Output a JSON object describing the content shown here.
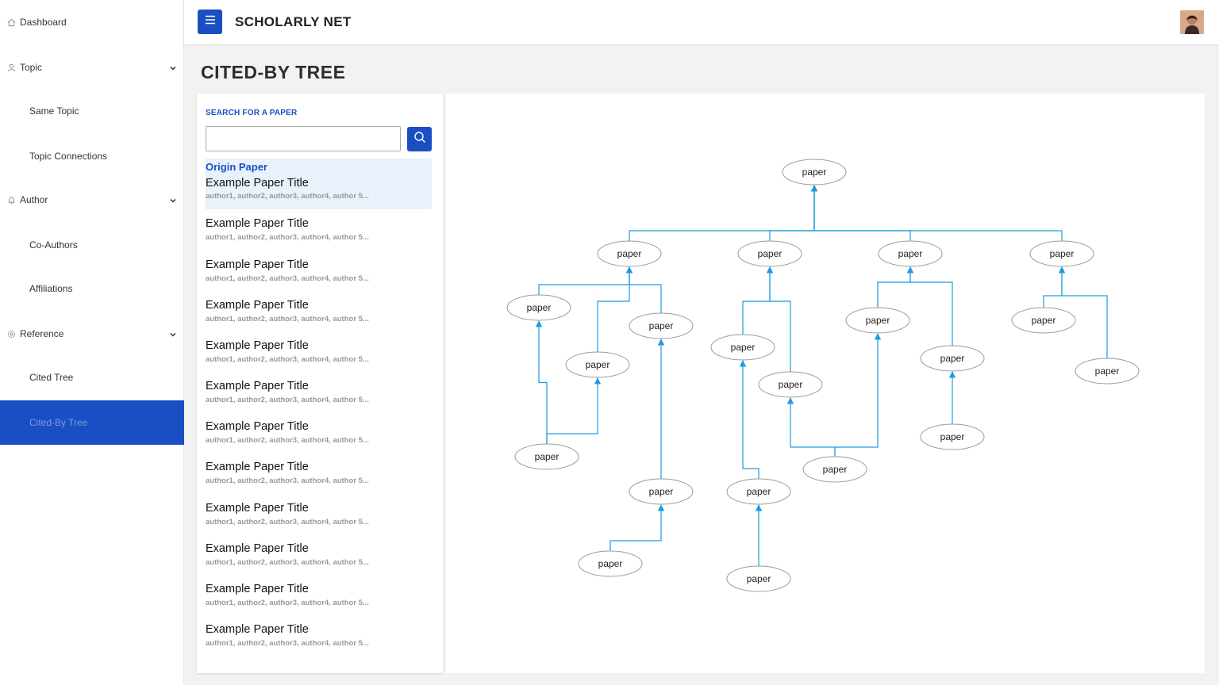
{
  "sidebar": {
    "items": [
      {
        "label": "Dashboard",
        "icon": "home-icon"
      },
      {
        "label": "Topic",
        "icon": "person-icon"
      },
      {
        "label": "Same Topic"
      },
      {
        "label": "Topic Connections"
      },
      {
        "label": "Author",
        "icon": "bell-icon"
      },
      {
        "label": "Co-Authors"
      },
      {
        "label": "Affiliations"
      },
      {
        "label": "Reference",
        "icon": "gear-icon"
      },
      {
        "label": "Cited Tree"
      },
      {
        "label": "Cited-By Tree",
        "active": true
      }
    ]
  },
  "header": {
    "brand": "SCHOLARLY NET",
    "menu_icon": "hamburger-icon",
    "avatar": "user-avatar"
  },
  "page": {
    "title": "CITED-BY TREE"
  },
  "search": {
    "label": "SEARCH FOR A PAPER",
    "value": "",
    "placeholder": "",
    "button_icon": "search-icon"
  },
  "origin": {
    "label": "Origin Paper",
    "title": "Example Paper Title",
    "authors": "author1, author2, author3, author4, author 5..."
  },
  "results": [
    {
      "title": "Example Paper Title",
      "authors": "author1, author2, author3, author4, author 5..."
    },
    {
      "title": "Example Paper Title",
      "authors": "author1, author2, author3, author4, author 5..."
    },
    {
      "title": "Example Paper Title",
      "authors": "author1, author2, author3, author4, author 5..."
    },
    {
      "title": "Example Paper Title",
      "authors": "author1, author2, author3, author4, author 5..."
    },
    {
      "title": "Example Paper Title",
      "authors": "author1, author2, author3, author4, author 5..."
    },
    {
      "title": "Example Paper Title",
      "authors": "author1, author2, author3, author4, author 5..."
    },
    {
      "title": "Example Paper Title",
      "authors": "author1, author2, author3, author4, author 5..."
    },
    {
      "title": "Example Paper Title",
      "authors": "author1, author2, author3, author4, author 5..."
    },
    {
      "title": "Example Paper Title",
      "authors": "author1, author2, author3, author4, author 5..."
    },
    {
      "title": "Example Paper Title",
      "authors": "author1, author2, author3, author4, author 5..."
    },
    {
      "title": "Example Paper Title",
      "authors": "author1, author2, author3, author4, author 5..."
    }
  ],
  "tree": {
    "node_label": "paper",
    "edge_color": "#1e9be0",
    "node_count": 23
  },
  "colors": {
    "accent": "#1a4fc4",
    "edge": "#1e9be0",
    "active_text": "#7f9ad9",
    "origin_bg": "#e9f1fb"
  }
}
